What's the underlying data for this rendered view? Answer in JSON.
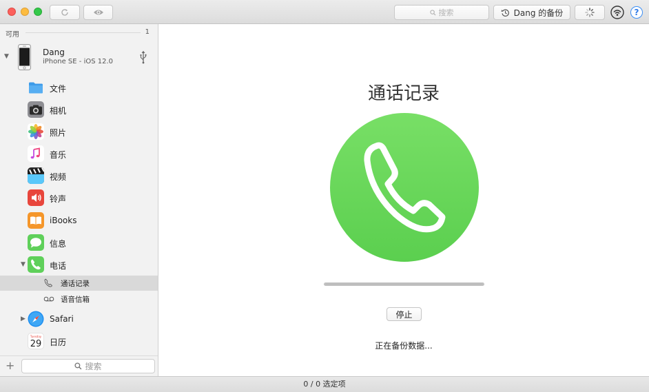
{
  "toolbar": {
    "search_placeholder": "搜索",
    "backup_label": "Dang 的备份",
    "help_label": "?"
  },
  "sidebar": {
    "section_title": "可用",
    "section_count": "1",
    "device": {
      "name": "Dang",
      "subtitle": "iPhone SE - iOS 12.0"
    },
    "items": [
      {
        "label": "文件",
        "icon": "folder-icon"
      },
      {
        "label": "相机",
        "icon": "camera-icon"
      },
      {
        "label": "照片",
        "icon": "photos-icon"
      },
      {
        "label": "音乐",
        "icon": "music-icon"
      },
      {
        "label": "视频",
        "icon": "video-icon"
      },
      {
        "label": "铃声",
        "icon": "ringtone-icon"
      },
      {
        "label": "iBooks",
        "icon": "ibooks-icon"
      },
      {
        "label": "信息",
        "icon": "messages-icon"
      },
      {
        "label": "电话",
        "icon": "phone-icon",
        "expanded": true
      },
      {
        "label": "Safari",
        "icon": "safari-icon"
      },
      {
        "label": "日历",
        "icon": "calendar-icon",
        "icon_text": {
          "day": "Tuesday",
          "date": "29"
        }
      }
    ],
    "phone_subitems": [
      {
        "label": "通话记录",
        "icon": "call-history-icon",
        "selected": true
      },
      {
        "label": "语音信箱",
        "icon": "voicemail-icon"
      }
    ],
    "search_placeholder": "搜索"
  },
  "main": {
    "title": "通话记录",
    "icon": "phone-call-icon",
    "progress": 1.0,
    "stop_label": "停止",
    "status": "正在备份数据..."
  },
  "statusbar": {
    "text": "0 / 0 选定项"
  },
  "colors": {
    "phone_green": "#6ad85c",
    "accent_blue": "#2f7be8"
  }
}
